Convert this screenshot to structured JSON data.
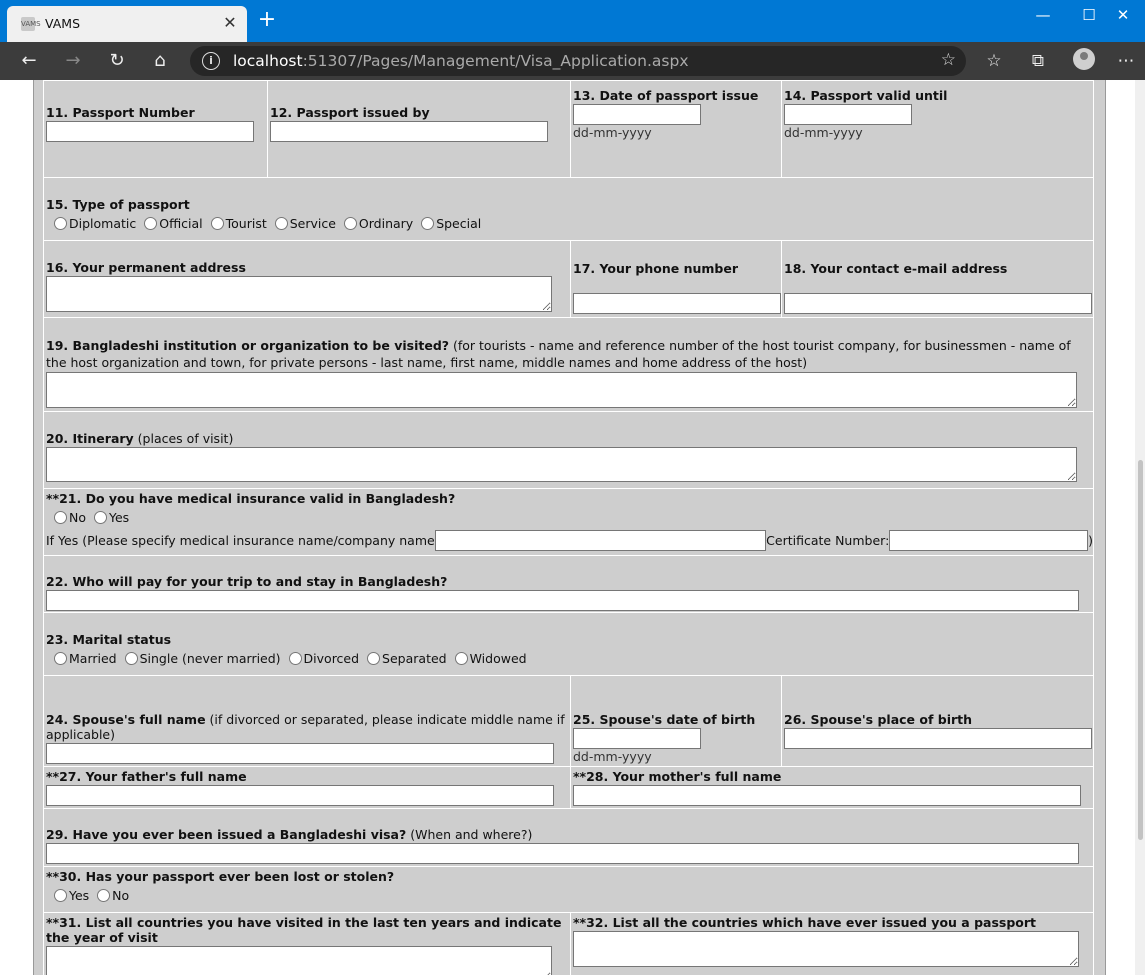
{
  "browser": {
    "tab_title": "VAMS",
    "tab_favicon_text": "VAMS",
    "url_host": "localhost",
    "url_path": ":51307/Pages/Management/Visa_Application.aspx"
  },
  "form": {
    "q11": "11. Passport Number",
    "q12": "12. Passport issued by",
    "q13": "13. Date of passport issue",
    "q14": "14. Passport valid until",
    "date_hint": "dd-mm-yyyy",
    "q15": "15. Type of passport",
    "passport_types": [
      "Diplomatic",
      "Official",
      "Tourist",
      "Service",
      "Ordinary",
      "Special"
    ],
    "q16": "16. Your permanent address",
    "q17": "17. Your phone number",
    "q18": "18. Your contact e-mail address",
    "q19": "19. Bangladeshi institution or organization to be visited?",
    "q19_note": " (for tourists - name and reference number of the host tourist company, for businessmen - name of the host organization and town, for private persons - last name, first name, middle names and home address of the host)",
    "q20": "20. Itinerary",
    "q20_note": " (places of visit)",
    "q21": "**21. Do you have medical insurance valid in Bangladesh?",
    "yes_no": [
      "No",
      "Yes"
    ],
    "insurance_name_label": "If Yes (Please specify medical insurance name/company name",
    "certificate_label": "Certificate Number:",
    "certificate_close": ")",
    "q22": "22. Who will pay for your trip to and stay in Bangladesh?",
    "q23": "23. Marital status",
    "marital_options": [
      "Married",
      "Single (never married)",
      "Divorced",
      "Separated",
      "Widowed"
    ],
    "q24": "24. Spouse's full name",
    "q24_note": " (if divorced or separated, please indicate middle name if applicable)",
    "q25": "25. Spouse's date of birth",
    "q26": "26. Spouse's place of birth",
    "q27": "**27. Your father's full name",
    "q28": "**28. Your mother's full name",
    "q29": "29. Have you ever been issued a Bangladeshi visa?",
    "q29_note": " (When and where?)",
    "q30": "**30. Has your passport ever been lost or stolen?",
    "yes_no_30": [
      "Yes",
      "No"
    ],
    "q31": "**31. List all countries you have visited in the last ten years and indicate the year of visit",
    "q32": "**32. List all the countries which have ever issued you a passport"
  }
}
